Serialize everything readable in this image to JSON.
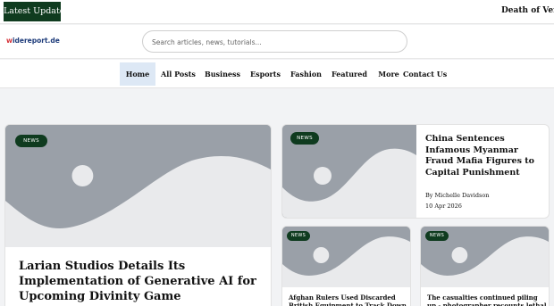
{
  "ticker": {
    "label": "Latest Update",
    "headline": "Death of Venezuela's"
  },
  "header": {
    "logo_accent": "w",
    "logo_rest": "idereport.de",
    "search_placeholder": "Search articles, news, tutorials..."
  },
  "nav": {
    "items": [
      {
        "label": "Home",
        "active": true
      },
      {
        "label": "All Posts"
      },
      {
        "label": "Business"
      },
      {
        "label": "Esports"
      },
      {
        "label": "Fashion"
      },
      {
        "label": "Featured"
      },
      {
        "label": "More"
      },
      {
        "label": "Contact Us"
      }
    ]
  },
  "articles": {
    "main": {
      "badge": "NEWS",
      "title": "Larian Studios Details Its Implementation of Generative AI for Upcoming Divinity Game"
    },
    "side": {
      "badge": "NEWS",
      "title": "China Sentences Infamous Myanmar Fraud Mafia Figures to Capital Punishment",
      "author": "By Michelle Davidson",
      "date": "10 Apr 2026"
    },
    "small_1": {
      "badge": "NEWS",
      "title": "Afghan Rulers Used Discarded British Equipment to Track Down"
    },
    "small_2": {
      "badge": "NEWS",
      "title": "The casualties continued piling up - photographer recounts lethal Bio"
    }
  },
  "colors": {
    "badge_bg": "#0f3b1f",
    "placeholder_bg": "#9aa0a8",
    "nav_active_bg": "#dde8f5"
  }
}
